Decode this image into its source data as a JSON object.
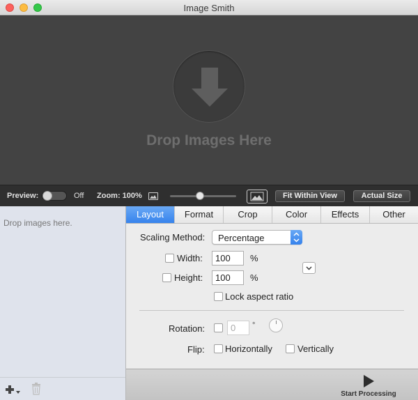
{
  "window": {
    "title": "Image Smith"
  },
  "dropzone": {
    "text": "Drop Images Here"
  },
  "toolbar": {
    "preview_label": "Preview:",
    "preview_state": "Off",
    "zoom_label": "Zoom: 100%",
    "zoom_level": 0.45,
    "fit_label": "Fit Within View",
    "actual_label": "Actual Size"
  },
  "sidebar": {
    "empty_message": "Drop images here."
  },
  "tabs": [
    "Layout",
    "Format",
    "Crop",
    "Color",
    "Effects",
    "Other"
  ],
  "layout": {
    "scaling_label": "Scaling Method:",
    "scaling_value": "Percentage",
    "width_label": "Width:",
    "width_value": "100",
    "height_label": "Height:",
    "height_value": "100",
    "unit": "%",
    "lock_label": "Lock aspect ratio",
    "rotation_label": "Rotation:",
    "rotation_value": "0",
    "rotation_unit": "°",
    "flip_label": "Flip:",
    "flip_horizontal": "Horizontally",
    "flip_vertical": "Vertically"
  },
  "actions": {
    "start_label": "Start Processing"
  },
  "colors": {
    "accent": "#3683ec",
    "dropzone_bg": "#434343",
    "toolbar_bg": "#2f2f2f"
  }
}
